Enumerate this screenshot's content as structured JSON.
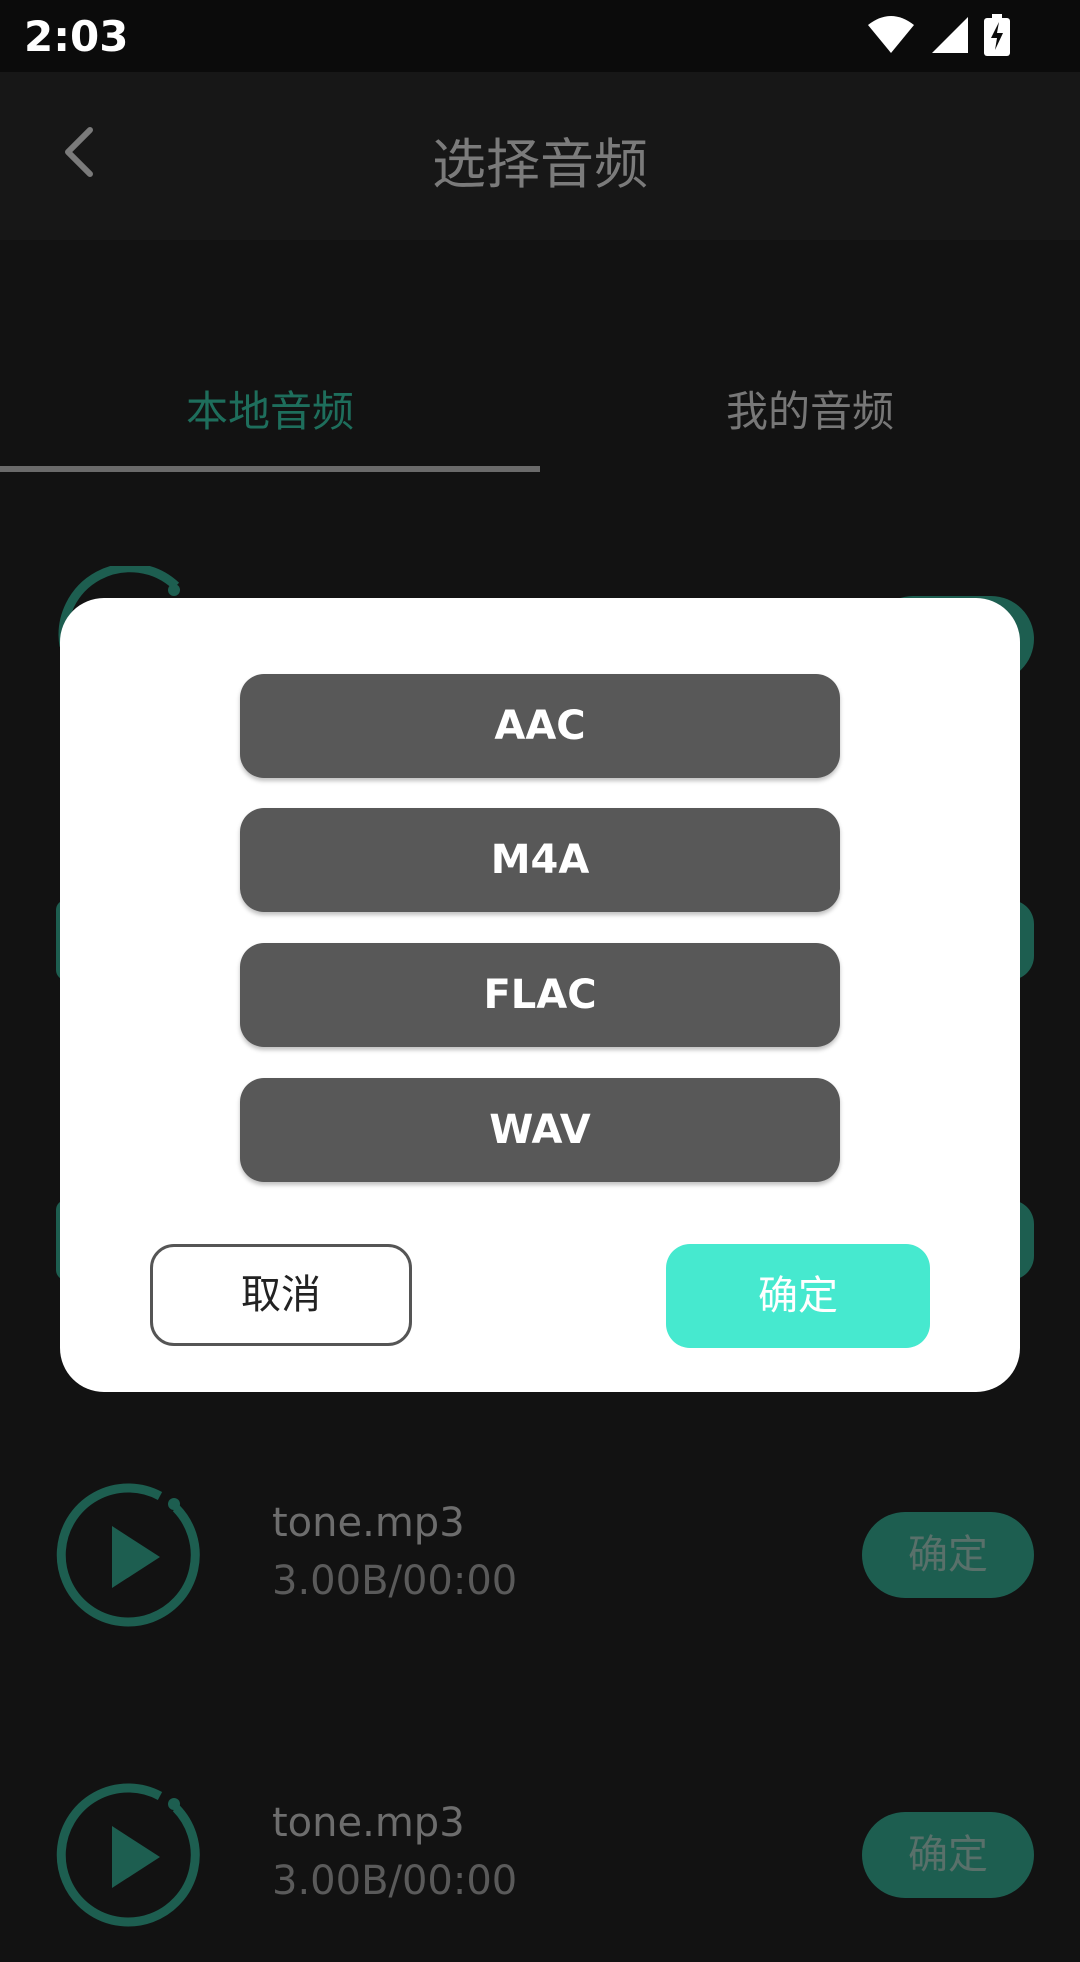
{
  "status_bar": {
    "time": "2:03",
    "icons": [
      "wifi-icon",
      "signal-icon",
      "battery-charging-icon"
    ]
  },
  "app_bar": {
    "title": "选择音频",
    "back_icon": "chevron-left-icon"
  },
  "tabs": [
    {
      "label": "本地音频",
      "selected": true
    },
    {
      "label": "我的音频",
      "selected": false
    }
  ],
  "list": {
    "items": [
      {
        "name": "tone.mp3",
        "meta": "3.00B/00:00",
        "button": "确定"
      },
      {
        "name": "tone.mp3",
        "meta": "3.00B/00:00",
        "button": "确定"
      }
    ]
  },
  "dialog": {
    "formats": [
      "AAC",
      "M4A",
      "FLAC",
      "WAV"
    ],
    "cancel_label": "取消",
    "confirm_label": "确定"
  },
  "colors": {
    "accent": "#46e9cf",
    "tab_selected": "#1e6e5c",
    "row_button": "#1d5e50",
    "format_button": "#585858"
  }
}
